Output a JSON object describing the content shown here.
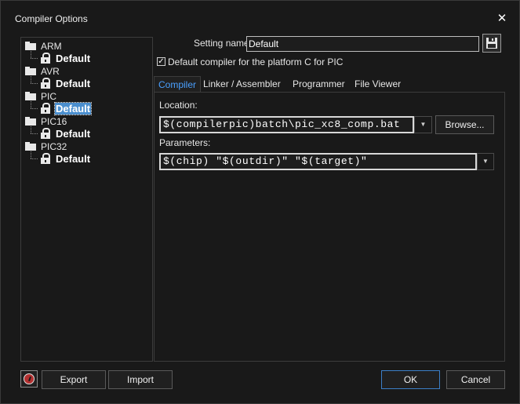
{
  "window": {
    "title": "Compiler Options",
    "close_symbol": "✕"
  },
  "tree": {
    "platforms": [
      {
        "label": "ARM",
        "child": "Default",
        "selected": false
      },
      {
        "label": "AVR",
        "child": "Default",
        "selected": false
      },
      {
        "label": "PIC",
        "child": "Default",
        "selected": true
      },
      {
        "label": "PIC16",
        "child": "Default",
        "selected": false
      },
      {
        "label": "PIC32",
        "child": "Default",
        "selected": false
      }
    ]
  },
  "setting": {
    "label": "Setting name:",
    "value": "Default",
    "save_icon": "floppy-disk-icon"
  },
  "default_checkbox": {
    "checked": true,
    "label": "Default compiler for the platform C for PIC"
  },
  "tabs": [
    {
      "label": "Compiler",
      "active": true
    },
    {
      "label": "Linker / Assembler",
      "active": false
    },
    {
      "label": "Programmer",
      "active": false
    },
    {
      "label": "File Viewer",
      "active": false
    }
  ],
  "compiler": {
    "location_label": "Location:",
    "location_value": "$(compilerpic)batch\\pic_xc8_comp.bat",
    "browse_label": "Browse...",
    "parameters_label": "Parameters:",
    "parameters_value": "$(chip) \"$(outdir)\" \"$(target)\"",
    "dropdown_icon": "chevron-down-icon"
  },
  "footer": {
    "help_icon": "help-icon",
    "export_label": "Export",
    "import_label": "Import",
    "ok_label": "OK",
    "cancel_label": "Cancel"
  },
  "colors": {
    "background": "#191919",
    "accent": "#4aa0ff",
    "selection": "#4b8fcf"
  }
}
